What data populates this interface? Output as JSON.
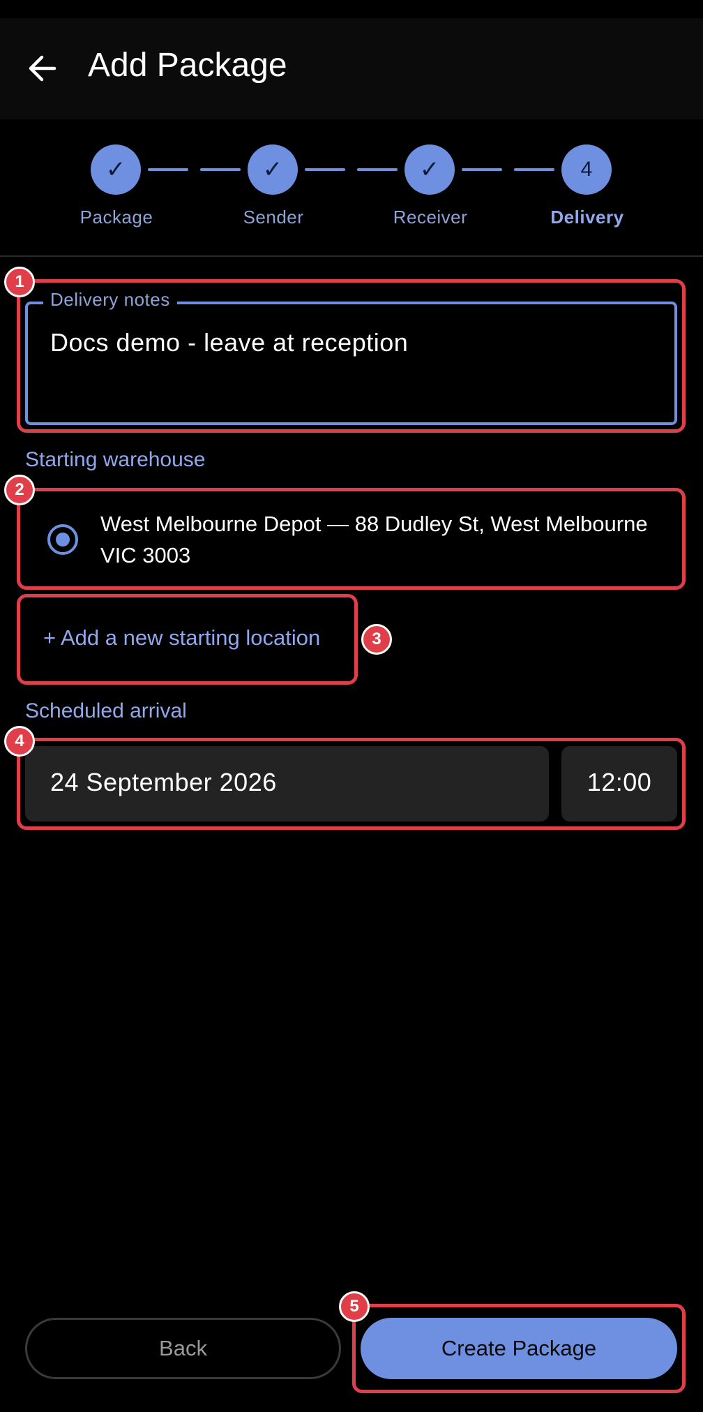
{
  "header": {
    "title": "Add Package",
    "back_icon": "arrow-left-icon"
  },
  "stepper": {
    "steps": [
      {
        "label": "Package",
        "marker": "✓",
        "state": "done"
      },
      {
        "label": "Sender",
        "marker": "✓",
        "state": "done"
      },
      {
        "label": "Receiver",
        "marker": "✓",
        "state": "done"
      },
      {
        "label": "Delivery",
        "marker": "4",
        "state": "active"
      }
    ]
  },
  "delivery_notes": {
    "label": "Delivery notes",
    "value": "Docs demo - leave at reception"
  },
  "warehouse": {
    "section_label": "Starting warehouse",
    "options": [
      {
        "text": "West Melbourne Depot — 88 Dudley St, West Melbourne VIC 3003",
        "selected": true
      }
    ],
    "add_link": "+ Add a new starting location"
  },
  "arrival": {
    "section_label": "Scheduled arrival",
    "date": "24 September 2026",
    "time": "12:00"
  },
  "footer": {
    "back_label": "Back",
    "create_label": "Create Package"
  },
  "annotations": {
    "b1": "1",
    "b2": "2",
    "b3": "3",
    "b4": "4",
    "b5": "5"
  },
  "colors": {
    "accent": "#6f8fe0",
    "highlight": "#e03f4a",
    "background": "#000000"
  }
}
